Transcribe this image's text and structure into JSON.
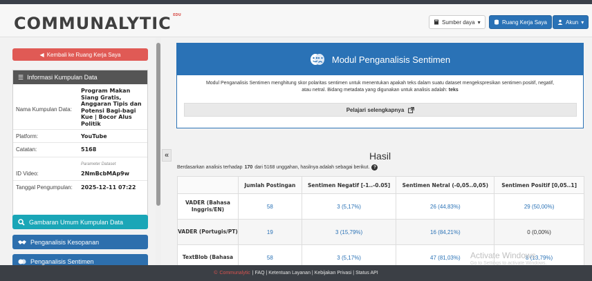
{
  "app": {
    "logo": "COMMUNALYTIC",
    "logo_badge": "EDU"
  },
  "header": {
    "resources_label": "Sumber daya",
    "workspace_label": "Ruang Kerja Saya",
    "account_label": "Akun"
  },
  "sidebar": {
    "back_label": "Kembali ke Ruang Kerja Saya",
    "info_title": "Informasi Kumpulan Data",
    "rows": {
      "name_label": "Nama Kumpulan Data:",
      "name_value": "Program Makan Siang Gratis, Anggaran Tipis dan Potensi Bagi-bagi Kue | Bocor Alus Politik",
      "platform_label": "Platform:",
      "platform_value": "YouTube",
      "records_label": "Catatan:",
      "records_value": "5168",
      "meta_note": "Parameter Dataset",
      "video_label": "ID Video:",
      "video_value": "2NmBcbMAp9w",
      "date_label": "Tanggal Pengumpulan:",
      "date_value": "2025-12-11 07:22"
    },
    "nav": [
      {
        "label": "Gambaran Umum Kumpulan Data"
      },
      {
        "label": "Penganalisis Kesopanan"
      },
      {
        "label": "Penganalisis Sentimen"
      }
    ]
  },
  "module": {
    "title": "Modul Penganalisis Sentimen",
    "description_1": "Modul Penganalisis Sentimen menghitung skor polaritas sentimen untuk menentukan apakah teks dalam suatu dataset mengekspresikan sentimen positif, negatif,",
    "description_2": "atau netral. Bidang metadata yang digunakan untuk analisis adalah:",
    "description_field": "teks",
    "learn_more": "Pelajari selengkapnya"
  },
  "results": {
    "title": "Hasil",
    "sub_prefix": "Berdasarkan analisis terhadap",
    "sub_count": "170",
    "sub_mid": "dari 5168 unggahan, hasilnya adalah sebagai berikut.",
    "columns": [
      "",
      "Jumlah Postingan",
      "Sentimen Negatif [-1..-0.05]",
      "Sentimen Netral (-0,05..0,05)",
      "Sentimen Positif [0,05..1]"
    ],
    "rows": [
      {
        "model": "VADER (Bahasa Inggris/EN)",
        "posts": "58",
        "neg": "3 (5,17%)",
        "neu": "26 (44,83%)",
        "pos": "29 (50,00%)"
      },
      {
        "model": "VADER (Portugis/PT)",
        "posts": "19",
        "neg": "3 (15,79%)",
        "neu": "16 (84,21%)",
        "pos": "0 (0,00%)"
      },
      {
        "model": "TextBlob (Bahasa",
        "posts": "58",
        "neg": "3 (5,17%)",
        "neu": "47 (81,03%)",
        "pos": "8 (13,79%)"
      }
    ]
  },
  "footer": {
    "copyright": "©",
    "brand": "Communalytic",
    "links": "| FAQ | Ketentuan Layanan | Kebijakan Privasi | Status API"
  },
  "watermark": {
    "line1": "Activate Windows",
    "line2": "Go to Settings to activate Windows."
  },
  "colors": {
    "primary": "#2a72b6",
    "danger": "#e05a55",
    "teal": "#1aa6b7",
    "footer": "#3b3f45"
  }
}
